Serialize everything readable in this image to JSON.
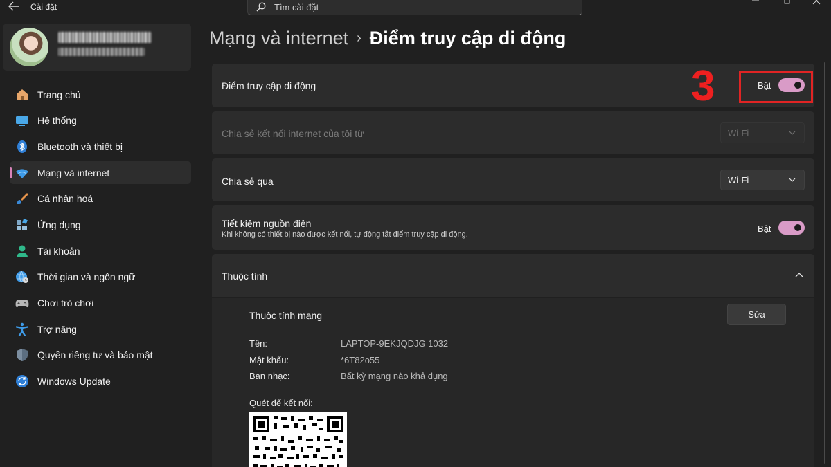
{
  "window": {
    "title": "Cài đặt",
    "search_placeholder": "Tìm cài đặt"
  },
  "profile": {
    "name": "",
    "email": ""
  },
  "sidebar": {
    "items": [
      {
        "label": "Trang chủ",
        "icon": "home-icon"
      },
      {
        "label": "Hệ thống",
        "icon": "system-icon"
      },
      {
        "label": "Bluetooth và thiết bị",
        "icon": "bluetooth-icon"
      },
      {
        "label": "Mạng và internet",
        "icon": "wifi-icon",
        "active": true
      },
      {
        "label": "Cá nhân hoá",
        "icon": "brush-icon"
      },
      {
        "label": "Ứng dụng",
        "icon": "apps-icon"
      },
      {
        "label": "Tài khoản",
        "icon": "account-icon"
      },
      {
        "label": "Thời gian và ngôn ngữ",
        "icon": "globe-clock-icon"
      },
      {
        "label": "Chơi trò chơi",
        "icon": "gamepad-icon"
      },
      {
        "label": "Trợ năng",
        "icon": "accessibility-icon"
      },
      {
        "label": "Quyền riêng tư và bảo mật",
        "icon": "shield-icon"
      },
      {
        "label": "Windows Update",
        "icon": "update-icon"
      }
    ]
  },
  "header": {
    "parent": "Mạng và internet",
    "separator": "›",
    "current": "Điểm truy cập di động"
  },
  "hotspot": {
    "title": "Điểm truy cập di động",
    "toggle_label": "Bật",
    "toggle_on": true
  },
  "share_from": {
    "title": "Chia sẻ kết nối internet của tôi từ",
    "value": "Wi-Fi",
    "disabled": true
  },
  "share_over": {
    "title": "Chia sẻ qua",
    "value": "Wi-Fi"
  },
  "power_saving": {
    "title": "Tiết kiệm nguồn điện",
    "description": "Khi không có thiết bị nào được kết nối, tự động tắt điểm truy cập di động.",
    "toggle_label": "Bật",
    "toggle_on": true
  },
  "properties": {
    "title": "Thuộc tính",
    "section_title": "Thuộc tính mạng",
    "edit_label": "Sửa",
    "rows": [
      {
        "key": "Tên:",
        "value": "LAPTOP-9EKJQDJG 1032"
      },
      {
        "key": "Mật khẩu:",
        "value": "*6T82o55"
      },
      {
        "key": "Ban nhạc:",
        "value": "Bất kỳ mạng nào khả dụng"
      }
    ],
    "qr_label": "Quét để kết nối:"
  },
  "annotation": {
    "number": "3",
    "color": "#e02424"
  },
  "colors": {
    "accent": "#d99bc7",
    "background": "#202020",
    "card": "#2c2c2c"
  }
}
